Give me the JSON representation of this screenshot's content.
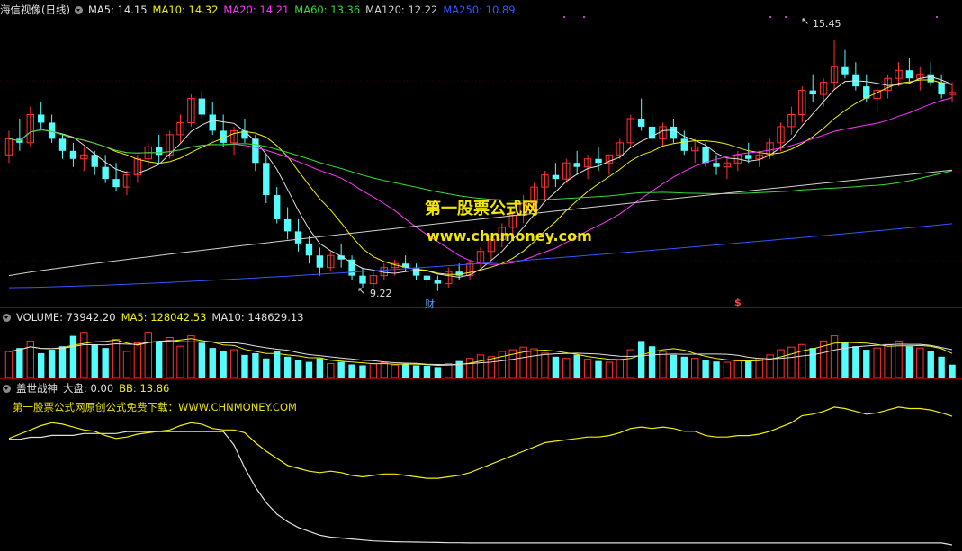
{
  "main_header": {
    "title": "海信视像(日线)",
    "items": [
      {
        "text": "MA5: 14.15",
        "color": "#e0e0e0"
      },
      {
        "text": "MA10: 14.32",
        "color": "#f0f000"
      },
      {
        "text": "MA20: 14.21",
        "color": "#ff33ff"
      },
      {
        "text": "MA60: 13.36",
        "color": "#33dd33"
      },
      {
        "text": "MA120: 12.22",
        "color": "#d0d0d0"
      },
      {
        "text": "MA250: 10.89",
        "color": "#3355ff"
      }
    ]
  },
  "volume_header": {
    "items": [
      {
        "text": "VOLUME: 73942.20",
        "color": "#e0e0e0"
      },
      {
        "text": "MA5: 128042.53",
        "color": "#f0f000"
      },
      {
        "text": "MA10: 148629.13",
        "color": "#e0e0e0"
      }
    ]
  },
  "indicator_header": {
    "items": [
      {
        "text": "盖世战神",
        "color": "#e0e0e0"
      },
      {
        "text": "大盘: 0.00",
        "color": "#e0e0e0"
      },
      {
        "text": "BB: 13.86",
        "color": "#f0f000"
      }
    ]
  },
  "watermark": {
    "line1": "第一股票公式网",
    "line2": "www.chnmoney.com"
  },
  "promo_text": "第一股票公式网原创公式免费下载：WWW.CHNMONEY.COM",
  "annotations": {
    "high": "15.45",
    "low": "9.22",
    "cai": "财",
    "dollar": "$"
  },
  "colors": {
    "up": "#ff3232",
    "down": "#54fcfc",
    "bg": "#000000",
    "grid": "#8b0000"
  },
  "chart_data": [
    {
      "type": "candlestick",
      "title": "海信视像(日线)",
      "price_range": [
        8.9,
        16.0
      ],
      "high_label": 15.45,
      "low_label": 9.22,
      "ohlc": [
        [
          12.6,
          13.2,
          12.4,
          13.0
        ],
        [
          13.0,
          13.5,
          12.7,
          12.9
        ],
        [
          12.9,
          13.8,
          12.8,
          13.6
        ],
        [
          13.6,
          13.9,
          13.2,
          13.4
        ],
        [
          13.4,
          13.6,
          12.9,
          13.0
        ],
        [
          13.0,
          13.1,
          12.5,
          12.7
        ],
        [
          12.7,
          12.9,
          12.3,
          12.5
        ],
        [
          12.5,
          12.8,
          12.2,
          12.6
        ],
        [
          12.6,
          12.7,
          12.1,
          12.3
        ],
        [
          12.3,
          12.6,
          11.9,
          12.0
        ],
        [
          12.0,
          12.4,
          11.7,
          11.8
        ],
        [
          11.8,
          12.2,
          11.6,
          12.1
        ],
        [
          12.1,
          12.6,
          11.9,
          12.5
        ],
        [
          12.5,
          12.9,
          12.3,
          12.8
        ],
        [
          12.8,
          13.1,
          12.4,
          12.6
        ],
        [
          12.6,
          13.2,
          12.5,
          13.1
        ],
        [
          13.1,
          13.6,
          12.9,
          13.4
        ],
        [
          13.4,
          14.1,
          13.3,
          14.0
        ],
        [
          14.0,
          14.2,
          13.5,
          13.6
        ],
        [
          13.6,
          13.9,
          13.1,
          13.2
        ],
        [
          13.2,
          13.6,
          12.8,
          12.9
        ],
        [
          12.9,
          13.3,
          12.6,
          13.2
        ],
        [
          13.2,
          13.5,
          12.9,
          13.0
        ],
        [
          13.0,
          13.1,
          12.2,
          12.4
        ],
        [
          12.4,
          12.6,
          11.4,
          11.6
        ],
        [
          11.6,
          11.8,
          10.9,
          11.0
        ],
        [
          11.0,
          11.3,
          10.5,
          10.7
        ],
        [
          10.7,
          11.0,
          10.2,
          10.4
        ],
        [
          10.4,
          10.6,
          9.9,
          10.1
        ],
        [
          10.1,
          10.3,
          9.6,
          9.8
        ],
        [
          9.8,
          10.2,
          9.7,
          10.1
        ],
        [
          10.1,
          10.4,
          9.8,
          10.0
        ],
        [
          10.0,
          10.1,
          9.5,
          9.6
        ],
        [
          9.6,
          9.8,
          9.3,
          9.4
        ],
        [
          9.4,
          9.7,
          9.3,
          9.6
        ],
        [
          9.6,
          9.9,
          9.5,
          9.8
        ],
        [
          9.8,
          10.0,
          9.6,
          9.9
        ],
        [
          9.9,
          10.1,
          9.7,
          9.8
        ],
        [
          9.8,
          9.9,
          9.5,
          9.6
        ],
        [
          9.6,
          9.7,
          9.3,
          9.5
        ],
        [
          9.5,
          9.6,
          9.22,
          9.4
        ],
        [
          9.4,
          9.8,
          9.3,
          9.7
        ],
        [
          9.7,
          9.9,
          9.5,
          9.6
        ],
        [
          9.6,
          10.0,
          9.5,
          9.9
        ],
        [
          9.9,
          10.3,
          9.8,
          10.2
        ],
        [
          10.2,
          10.6,
          10.0,
          10.5
        ],
        [
          10.5,
          10.9,
          10.3,
          10.8
        ],
        [
          10.8,
          11.2,
          10.6,
          11.1
        ],
        [
          11.1,
          11.6,
          10.9,
          11.4
        ],
        [
          11.4,
          11.9,
          11.2,
          11.8
        ],
        [
          11.8,
          12.2,
          11.5,
          12.1
        ],
        [
          12.1,
          12.4,
          11.8,
          12.0
        ],
        [
          12.0,
          12.5,
          11.9,
          12.4
        ],
        [
          12.4,
          12.7,
          12.1,
          12.3
        ],
        [
          12.3,
          12.6,
          12.0,
          12.5
        ],
        [
          12.5,
          12.8,
          12.2,
          12.4
        ],
        [
          12.4,
          12.6,
          12.1,
          12.6
        ],
        [
          12.6,
          13.0,
          12.5,
          12.9
        ],
        [
          12.9,
          13.6,
          12.8,
          13.5
        ],
        [
          13.5,
          14.0,
          13.2,
          13.3
        ],
        [
          13.3,
          13.6,
          12.9,
          13.0
        ],
        [
          13.0,
          13.4,
          12.8,
          13.3
        ],
        [
          13.3,
          13.5,
          12.9,
          13.0
        ],
        [
          13.0,
          13.2,
          12.6,
          12.7
        ],
        [
          12.7,
          13.0,
          12.4,
          12.8
        ],
        [
          12.8,
          12.9,
          12.3,
          12.4
        ],
        [
          12.4,
          12.6,
          12.1,
          12.3
        ],
        [
          12.3,
          12.5,
          12.0,
          12.4
        ],
        [
          12.4,
          12.7,
          12.2,
          12.6
        ],
        [
          12.6,
          12.9,
          12.4,
          12.5
        ],
        [
          12.5,
          12.7,
          12.3,
          12.6
        ],
        [
          12.6,
          13.0,
          12.5,
          12.9
        ],
        [
          12.9,
          13.4,
          12.7,
          13.3
        ],
        [
          13.3,
          13.8,
          13.1,
          13.6
        ],
        [
          13.6,
          14.3,
          13.4,
          14.2
        ],
        [
          14.2,
          14.6,
          13.9,
          14.1
        ],
        [
          14.1,
          14.5,
          13.8,
          14.4
        ],
        [
          14.4,
          15.45,
          14.2,
          14.8
        ],
        [
          14.8,
          15.2,
          14.5,
          14.6
        ],
        [
          14.6,
          14.9,
          14.2,
          14.3
        ],
        [
          14.3,
          14.6,
          13.9,
          14.0
        ],
        [
          14.0,
          14.3,
          13.7,
          14.2
        ],
        [
          14.2,
          14.6,
          14.0,
          14.5
        ],
        [
          14.5,
          14.9,
          14.3,
          14.7
        ],
        [
          14.7,
          15.0,
          14.4,
          14.5
        ],
        [
          14.5,
          14.8,
          14.2,
          14.6
        ],
        [
          14.6,
          14.9,
          14.3,
          14.4
        ],
        [
          14.4,
          14.6,
          14.0,
          14.1
        ],
        [
          14.1,
          14.4,
          13.9,
          14.15
        ]
      ],
      "ma_series": [
        {
          "name": "MA5",
          "color": "#e0e0e0",
          "last": 14.15
        },
        {
          "name": "MA10",
          "color": "#f0f000",
          "last": 14.32
        },
        {
          "name": "MA20",
          "color": "#ff33ff",
          "last": 14.21
        },
        {
          "name": "MA60",
          "color": "#33dd33",
          "last": 13.36
        },
        {
          "name": "MA120",
          "color": "#d0d0d0",
          "last": 12.22
        },
        {
          "name": "MA250",
          "color": "#3355ff",
          "last": 10.89
        }
      ]
    },
    {
      "type": "bar",
      "title": "VOLUME",
      "last_value": 73942.2,
      "ma5": 128042.53,
      "ma10": 148629.13,
      "ylim": [
        0,
        300000
      ],
      "values": [
        150000,
        170000,
        210000,
        140000,
        160000,
        180000,
        240000,
        260000,
        190000,
        170000,
        220000,
        150000,
        200000,
        260000,
        210000,
        230000,
        180000,
        240000,
        200000,
        170000,
        150000,
        160000,
        130000,
        140000,
        110000,
        150000,
        120000,
        100000,
        90000,
        110000,
        80000,
        90000,
        75000,
        70000,
        80000,
        85000,
        72000,
        78000,
        70000,
        68000,
        60000,
        80000,
        95000,
        110000,
        130000,
        120000,
        150000,
        160000,
        175000,
        165000,
        140000,
        120000,
        110000,
        130000,
        105000,
        95000,
        88000,
        100000,
        160000,
        210000,
        180000,
        150000,
        130000,
        120000,
        110000,
        100000,
        92000,
        88000,
        96000,
        100000,
        110000,
        130000,
        160000,
        175000,
        190000,
        170000,
        210000,
        240000,
        200000,
        180000,
        160000,
        170000,
        190000,
        210000,
        180000,
        170000,
        150000,
        120000,
        73942
      ],
      "up_flags": [
        1,
        0,
        1,
        0,
        0,
        0,
        0,
        1,
        0,
        0,
        1,
        1,
        1,
        1,
        0,
        1,
        1,
        1,
        0,
        0,
        0,
        1,
        0,
        0,
        0,
        0,
        0,
        0,
        0,
        0,
        1,
        0,
        0,
        0,
        1,
        1,
        1,
        0,
        0,
        0,
        0,
        1,
        0,
        1,
        1,
        1,
        1,
        1,
        1,
        1,
        1,
        0,
        1,
        0,
        1,
        0,
        1,
        1,
        1,
        0,
        0,
        1,
        0,
        0,
        1,
        0,
        0,
        1,
        1,
        0,
        1,
        1,
        1,
        1,
        1,
        0,
        1,
        1,
        0,
        0,
        0,
        1,
        1,
        1,
        0,
        1,
        0,
        0,
        0
      ]
    },
    {
      "type": "line",
      "title": "盖世战神",
      "series": [
        {
          "name": "大盘",
          "color": "#e0e0e0",
          "last": 0.0,
          "values": [
            55,
            55,
            56,
            56,
            57,
            57,
            57,
            58,
            58,
            58,
            58,
            59,
            59,
            59,
            59,
            59,
            59,
            59,
            59,
            59,
            59,
            52,
            40,
            30,
            22,
            16,
            12,
            9,
            7,
            5,
            4,
            3.5,
            3,
            2.5,
            2,
            1.8,
            1.6,
            1.5,
            1.4,
            1.3,
            1.2,
            1.1,
            1.1,
            1,
            1,
            1,
            1,
            1,
            1,
            1,
            1,
            1,
            1,
            1,
            1,
            1,
            1,
            1,
            1,
            1,
            1,
            1,
            1,
            1,
            1,
            1,
            1,
            1,
            1,
            1,
            1,
            1,
            1,
            1,
            1,
            1,
            1,
            1,
            1,
            1,
            1,
            1,
            1,
            1,
            1,
            1,
            1,
            1,
            0
          ]
        },
        {
          "name": "BB",
          "color": "#f0f000",
          "last": 13.86,
          "values": [
            12.3,
            12.6,
            12.9,
            13.2,
            13.4,
            13.3,
            13.1,
            12.9,
            12.8,
            12.5,
            12.3,
            12.4,
            12.6,
            12.7,
            12.8,
            12.9,
            13.2,
            13.4,
            13.3,
            13.0,
            12.9,
            12.9,
            12.7,
            12.0,
            11.4,
            10.9,
            10.4,
            10.2,
            10.0,
            9.9,
            10.0,
            9.9,
            9.7,
            9.6,
            9.7,
            9.8,
            9.8,
            9.7,
            9.6,
            9.5,
            9.5,
            9.6,
            9.7,
            9.9,
            10.2,
            10.5,
            10.8,
            11.1,
            11.4,
            11.7,
            12.0,
            12.1,
            12.2,
            12.3,
            12.4,
            12.4,
            12.5,
            12.7,
            13.0,
            13.1,
            13.0,
            13.1,
            13.0,
            12.8,
            12.8,
            12.5,
            12.4,
            12.4,
            12.5,
            12.5,
            12.6,
            12.8,
            13.1,
            13.4,
            13.9,
            14.0,
            14.2,
            14.5,
            14.4,
            14.2,
            14.0,
            14.1,
            14.3,
            14.5,
            14.4,
            14.4,
            14.3,
            14.1,
            13.86
          ]
        }
      ]
    }
  ]
}
